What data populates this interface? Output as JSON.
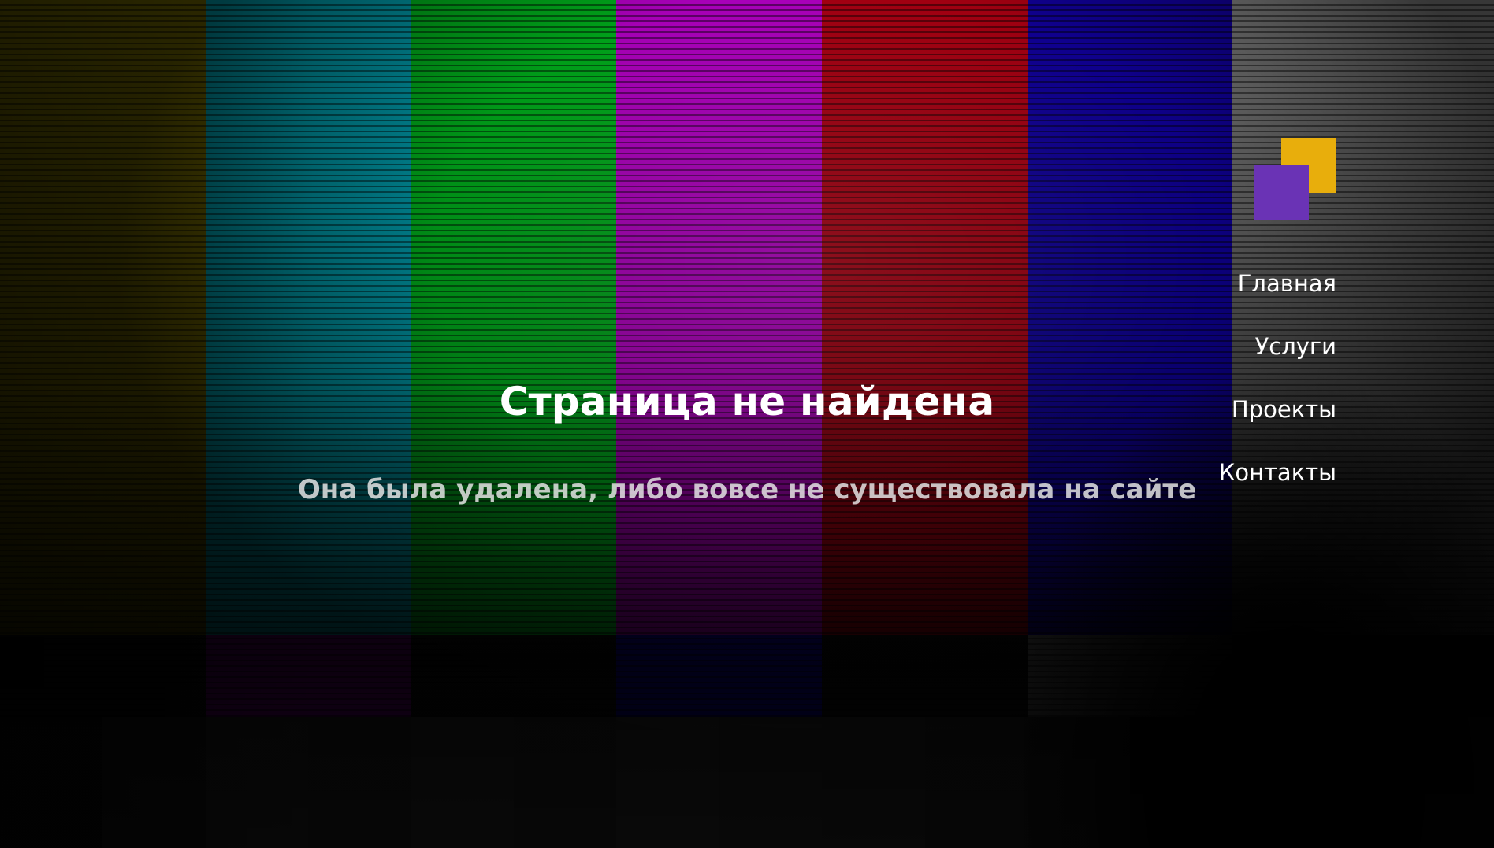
{
  "page": {
    "title": "Страница не найдена",
    "subtitle": "Она была удалена, либо вовсе не существовала на сайте"
  },
  "logo": {
    "colors": {
      "yellow": "#e8ae0c",
      "purple": "#6a33b5"
    }
  },
  "nav": {
    "items": [
      {
        "label": "Главная"
      },
      {
        "label": "Услуги"
      },
      {
        "label": "Проекты"
      },
      {
        "label": "Контакты"
      }
    ]
  },
  "background": {
    "top_bars": [
      "#6b6200",
      "#0097a8",
      "#00a419",
      "#a800b8",
      "#a60011",
      "#0e0090",
      "#757575"
    ],
    "mid_bars": [
      "#0a0a0a",
      "#3a0047",
      "#070707",
      "#02004d",
      "#060606",
      "#2e2e2e",
      "#000000"
    ],
    "bottom_bars": [
      "#0c0c0c",
      "#161616",
      "#131313",
      "#191919",
      "#151515",
      "#121212",
      "#0a0a0a"
    ]
  }
}
